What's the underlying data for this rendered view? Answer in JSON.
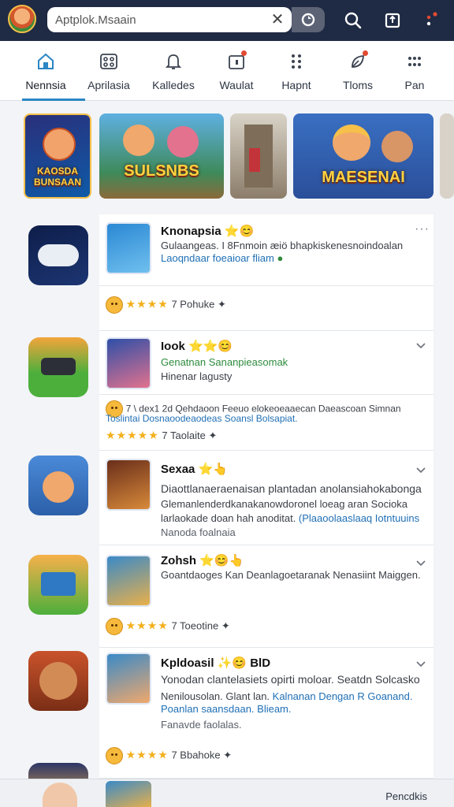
{
  "header": {
    "search_value": "Aptplok.Msaain",
    "clear_label": "✕"
  },
  "tabs": [
    {
      "label": "Nennsia",
      "icon": "home-icon"
    },
    {
      "label": "Aprilasia",
      "icon": "grid-icon"
    },
    {
      "label": "Kalledes",
      "icon": "bell-icon"
    },
    {
      "label": "Waulat",
      "icon": "wallet-icon"
    },
    {
      "label": "Hapnt",
      "icon": "apps-icon"
    },
    {
      "label": "Tloms",
      "icon": "leaf-icon"
    },
    {
      "label": "Pan",
      "icon": "dots-grid-icon"
    }
  ],
  "banners": [
    {
      "text": "KAOSDA BUNSAAN",
      "color": "#2a2f7a"
    },
    {
      "text": "SULSNBS",
      "color": "#3e8a5a"
    },
    {
      "text": "",
      "color": "#b2a692"
    },
    {
      "text": "MAESENAI",
      "color": "#3a6fc2"
    }
  ],
  "items": [
    {
      "name": "Knonapsia",
      "name_suffix": "⭐😊",
      "desc1": "Gulaangeas. I 8Fnmoin æiö bhapkiskenesnoindoalan",
      "desc2": "Laoqndaar foeaioar fliam",
      "rating_text": "7  Pohuke",
      "stars": "★★★★"
    },
    {
      "name": "Iook",
      "name_suffix": "⭐⭐😊",
      "desc1": "Genatnan Sananpieasomak",
      "desc2": "Hinenar lagusty",
      "extra1": "7 \\ dex1 2d Qehdaoon Feeuo elokeoeaaecan Daeascoan Simnan",
      "extra2": "Toslintai Dosnaoodeaodeas Soansl Bolsapiat.",
      "rating_text": "7  Taolaite",
      "stars": "★★★★★"
    },
    {
      "name": "Sexaa",
      "name_suffix": "⭐👆",
      "desc1": "Diaottlanaeraenaisan plantadan anolansiahokabonga",
      "desc2": "Glemanlenderdkanakanowdoronel loeag aran Socioka",
      "desc3": "larlaokade doan hah anoditat. ",
      "desc3_link": "(Plaaoolaaslaaq Iotntuuins",
      "desc4": "Nanoda foalnaia",
      "rating_text": "",
      "stars": ""
    },
    {
      "name": "Zohsh",
      "name_suffix": "⭐😊👆",
      "desc1": "Goantdaoges Kan Deanlagoetaranak Nenasiint Maiggen.",
      "rating_text": "7  Toeotine",
      "stars": "★★★★"
    },
    {
      "name": "Kpldoasil",
      "name_suffix": "✨😊 BlD",
      "desc1": "Yonodan clantelasiets opirti moloar. Seatdn Solcasko",
      "desc2": "Nenilousolan. Glant lan. ",
      "desc2_link": "Kalnanan Dengan R Goanand.",
      "desc3": "Poanlan saansdaan. Blieam.",
      "desc4": "Fanavde faolalas.",
      "rating_text": "7  Bbahoke",
      "stars": "★★★★"
    }
  ],
  "bottom": {
    "text": "Pencdkis"
  }
}
